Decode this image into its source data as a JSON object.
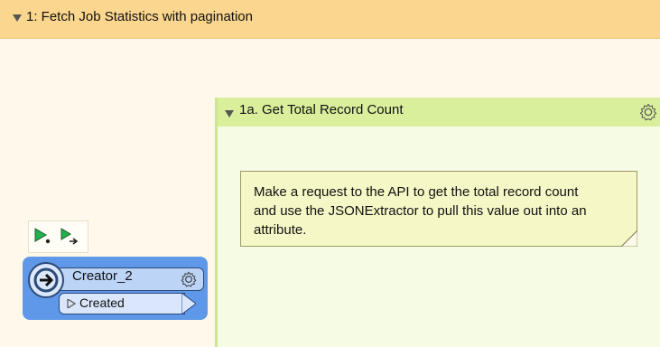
{
  "outer_bookmark": {
    "title": "1: Fetch Job Statistics with pagination"
  },
  "inner_bookmark": {
    "title": "1a. Get Total Record Count"
  },
  "annotation": {
    "line1": "Make a request to the API to get the total record count",
    "line2": "and use the JSONExtractor to pull this value out into an",
    "line3": "attribute."
  },
  "transformer": {
    "name": "Creator_2",
    "output_port": "Created"
  },
  "colors": {
    "outer_header": "#fbd68f",
    "inner_header": "#d9ef9c",
    "transformer": "#5f98e8",
    "note": "#f6f7c6"
  },
  "icons": [
    "collapse-triangle-icon",
    "gear-icon",
    "run-icon",
    "run-to-icon",
    "creator-icon",
    "port-triangle-icon"
  ]
}
